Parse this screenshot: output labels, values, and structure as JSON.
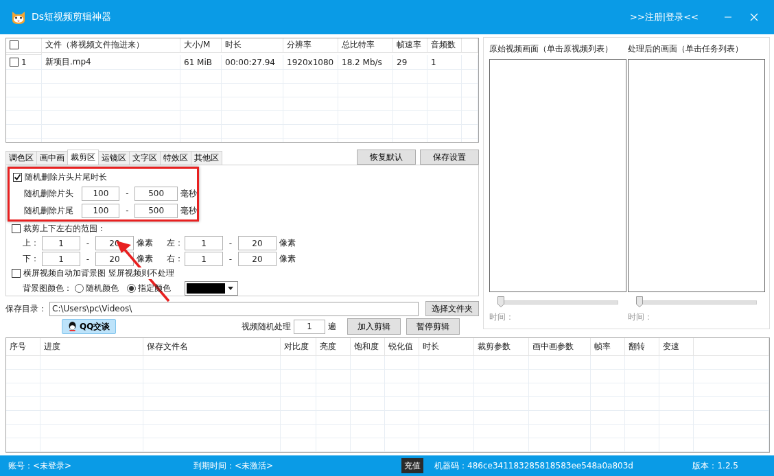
{
  "window": {
    "title": "Ds短视频剪辑神器",
    "register_link": ">>注册|登录<<"
  },
  "file_table": {
    "header_checked": false,
    "columns": [
      "文件（将视频文件拖进来）",
      "大小/M",
      "时长",
      "分辨率",
      "总比特率",
      "帧速率",
      "音频数"
    ],
    "rows": [
      {
        "checked": false,
        "index": "1",
        "cells": [
          "新项目.mp4",
          "61 MiB",
          "00:00:27.94",
          "1920x1080",
          "18.2 Mb/s",
          "29",
          "1"
        ]
      }
    ]
  },
  "tabs": [
    {
      "label": "调色区",
      "selected": false
    },
    {
      "label": "画中画",
      "selected": false
    },
    {
      "label": "裁剪区",
      "selected": true
    },
    {
      "label": "运镜区",
      "selected": false
    },
    {
      "label": "文字区",
      "selected": false
    },
    {
      "label": "特效区",
      "selected": false
    },
    {
      "label": "其他区",
      "selected": false
    }
  ],
  "tab_buttons": [
    "恢复默认",
    "保存设置"
  ],
  "trim": {
    "label": "随机删除片头片尾时长",
    "checked": true,
    "separator": "-",
    "rows": [
      {
        "label": "随机删除片头",
        "from": "100",
        "to": "500",
        "unit": "毫秒"
      },
      {
        "label": "随机删除片尾",
        "from": "100",
        "to": "500",
        "unit": "毫秒"
      }
    ]
  },
  "crop": {
    "label": "裁剪上下左右的范围：",
    "checked": false,
    "separator": "-",
    "rows": [
      {
        "label_a": "上：",
        "a_from": "1",
        "a_to": "20",
        "unit_a": "像素",
        "label_b": "左：",
        "b_from": "1",
        "b_to": "20",
        "unit_b": "像素"
      },
      {
        "label_a": "下：",
        "a_from": "1",
        "a_to": "20",
        "unit_a": "像素",
        "label_b": "右：",
        "b_from": "1",
        "b_to": "20",
        "unit_b": "像素"
      }
    ]
  },
  "background": {
    "label": "横屏视频自动加背景图 竖屏视频则不处理",
    "checked": false,
    "color_label": "背景图颜色：",
    "options": [
      {
        "label": "随机颜色",
        "selected": false
      },
      {
        "label": "指定颜色",
        "selected": true
      }
    ]
  },
  "save_dir": {
    "label": "保存目录：",
    "value": "C:\\Users\\pc\\Videos\\",
    "button": "选择文件夹"
  },
  "qq_button": "QQ交谈",
  "random_process": {
    "label": "视频随机处理",
    "value": "1",
    "unit": "遍"
  },
  "action_buttons": [
    "加入剪辑",
    "暂停剪辑"
  ],
  "task_table": {
    "columns": [
      "序号",
      "进度",
      "保存文件名",
      "对比度",
      "亮度",
      "饱和度",
      "锐化值",
      "时长",
      "裁剪参数",
      "画中画参数",
      "帧率",
      "翻转",
      "变速"
    ]
  },
  "preview": {
    "panes": [
      {
        "title": "原始视频画面（单击原视频列表）",
        "time_label": "时间：",
        "level": 0
      },
      {
        "title": "处理后的画面（单击任务列表）",
        "time_label": "时间：",
        "level": 0
      }
    ]
  },
  "status_bar": {
    "account": "账号：<未登录>",
    "expiry": "到期时间：<未激活>",
    "recharge": "充值",
    "machine_code": "机器码：486ce341183285818583ee548a0a803d",
    "version": "版本：1.2.5"
  }
}
